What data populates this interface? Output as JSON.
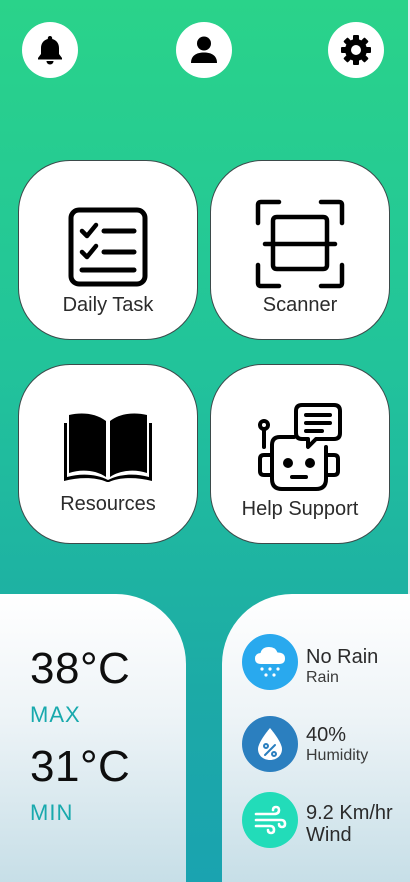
{
  "top_bar": {
    "icons": [
      "bell-icon",
      "user-icon",
      "gear-icon"
    ]
  },
  "cards": [
    {
      "label": "Daily Task",
      "icon": "checklist-icon"
    },
    {
      "label": "Scanner",
      "icon": "scan-icon"
    },
    {
      "label": "Resources",
      "icon": "book-icon"
    },
    {
      "label": "Help Support",
      "icon": "robot-chat-icon"
    }
  ],
  "temperature": {
    "max_value": "38°C",
    "max_label": "MAX",
    "min_value": "31°C",
    "min_label": "MIN"
  },
  "weather": {
    "rain": {
      "value": "No Rain",
      "label": "Rain",
      "icon": "rain-cloud-icon"
    },
    "humidity": {
      "value": "40%",
      "label": "Humidity",
      "icon": "humidity-icon"
    },
    "wind": {
      "value": "9.2 Km/hr",
      "label": "Wind",
      "icon": "wind-icon"
    }
  },
  "colors": {
    "background_top": "#2ad38a",
    "background_bottom": "#1aa3b0",
    "accent_teal": "#18a9ad",
    "rain_icon_bg": "#29a9ee",
    "humidity_icon_bg": "#2b7fbf",
    "wind_icon_bg": "#22dcb9"
  }
}
